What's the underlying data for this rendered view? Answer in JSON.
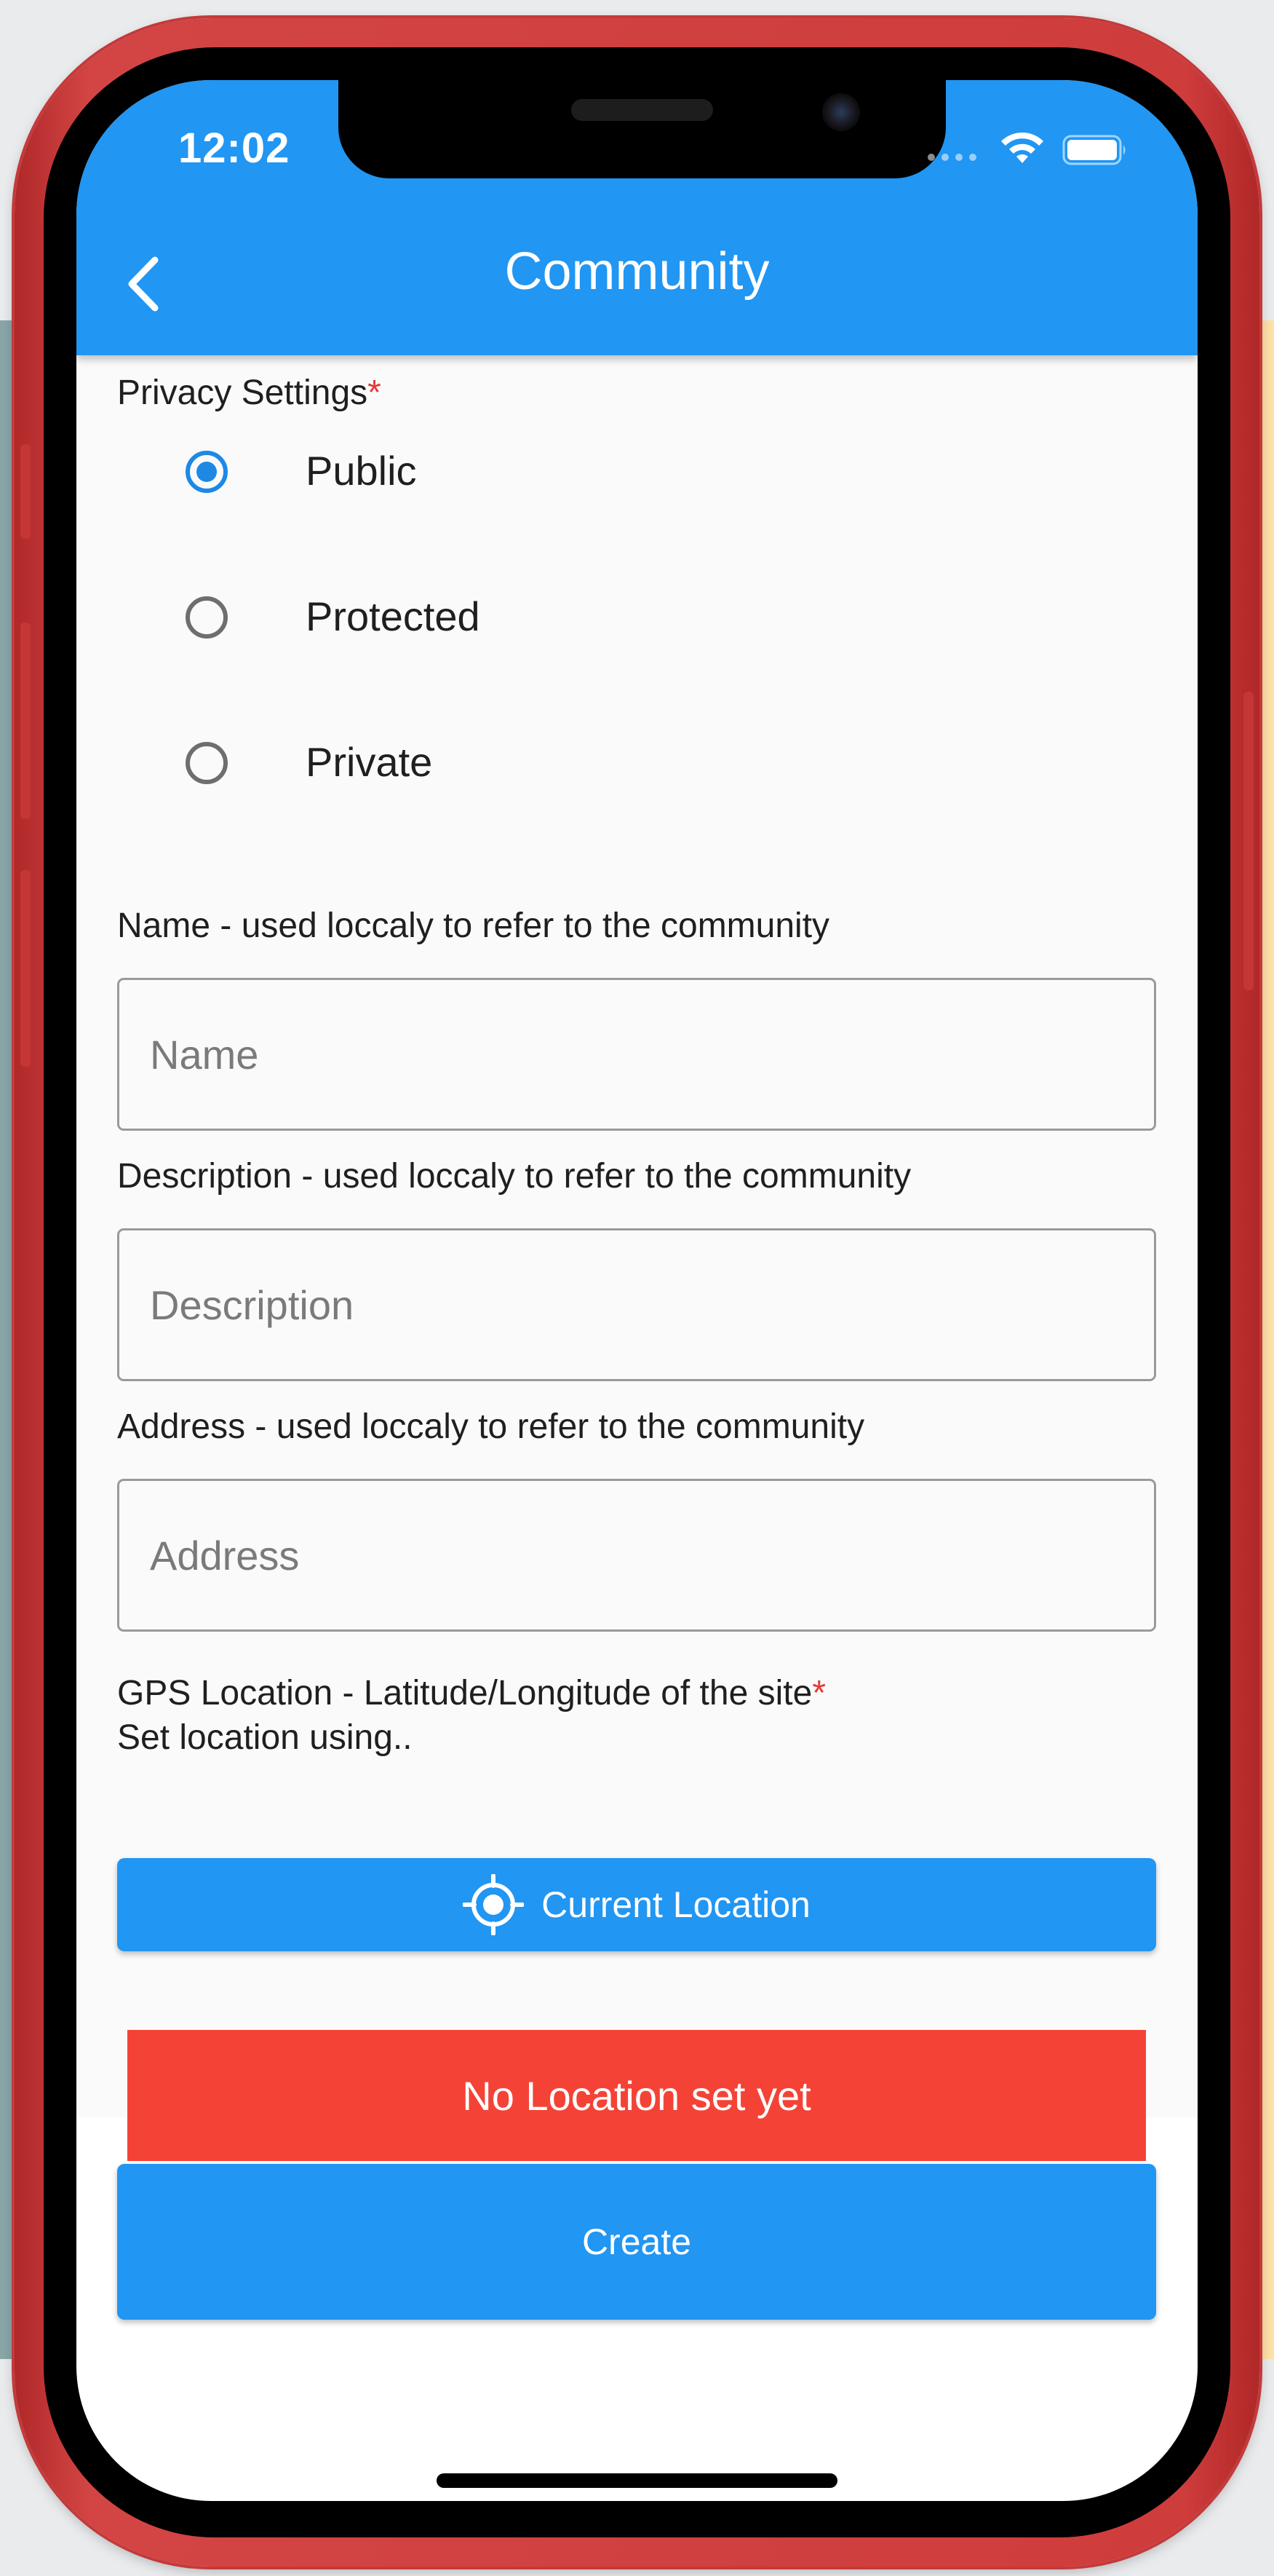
{
  "status_bar": {
    "time": "12:02"
  },
  "app_bar": {
    "title": "Community",
    "back_icon": "chevron-left-icon"
  },
  "privacy": {
    "label": "Privacy Settings",
    "required_mark": "*",
    "options": [
      {
        "label": "Public",
        "selected": true
      },
      {
        "label": "Protected",
        "selected": false
      },
      {
        "label": "Private",
        "selected": false
      }
    ]
  },
  "fields": {
    "name": {
      "label": "Name - used loccaly to refer to the  community",
      "placeholder": "Name",
      "value": ""
    },
    "description": {
      "label": "Description - used loccaly to refer to the  community",
      "placeholder": "Description",
      "value": ""
    },
    "address": {
      "label": "Address - used loccaly to refer to the  community",
      "placeholder": "Address",
      "value": ""
    }
  },
  "gps": {
    "label": "GPS Location - Latitude/Longitude of the site",
    "required_mark": "*",
    "sublabel": "Set location using..",
    "current_location_label": "Current Location",
    "current_location_icon": "gps-fixed-icon",
    "status_text": "No Location set yet"
  },
  "actions": {
    "create_label": "Create"
  },
  "colors": {
    "primary": "#2196f3",
    "error": "#f44336",
    "required": "#e53935",
    "phone_frame": "#cf3c3c"
  }
}
